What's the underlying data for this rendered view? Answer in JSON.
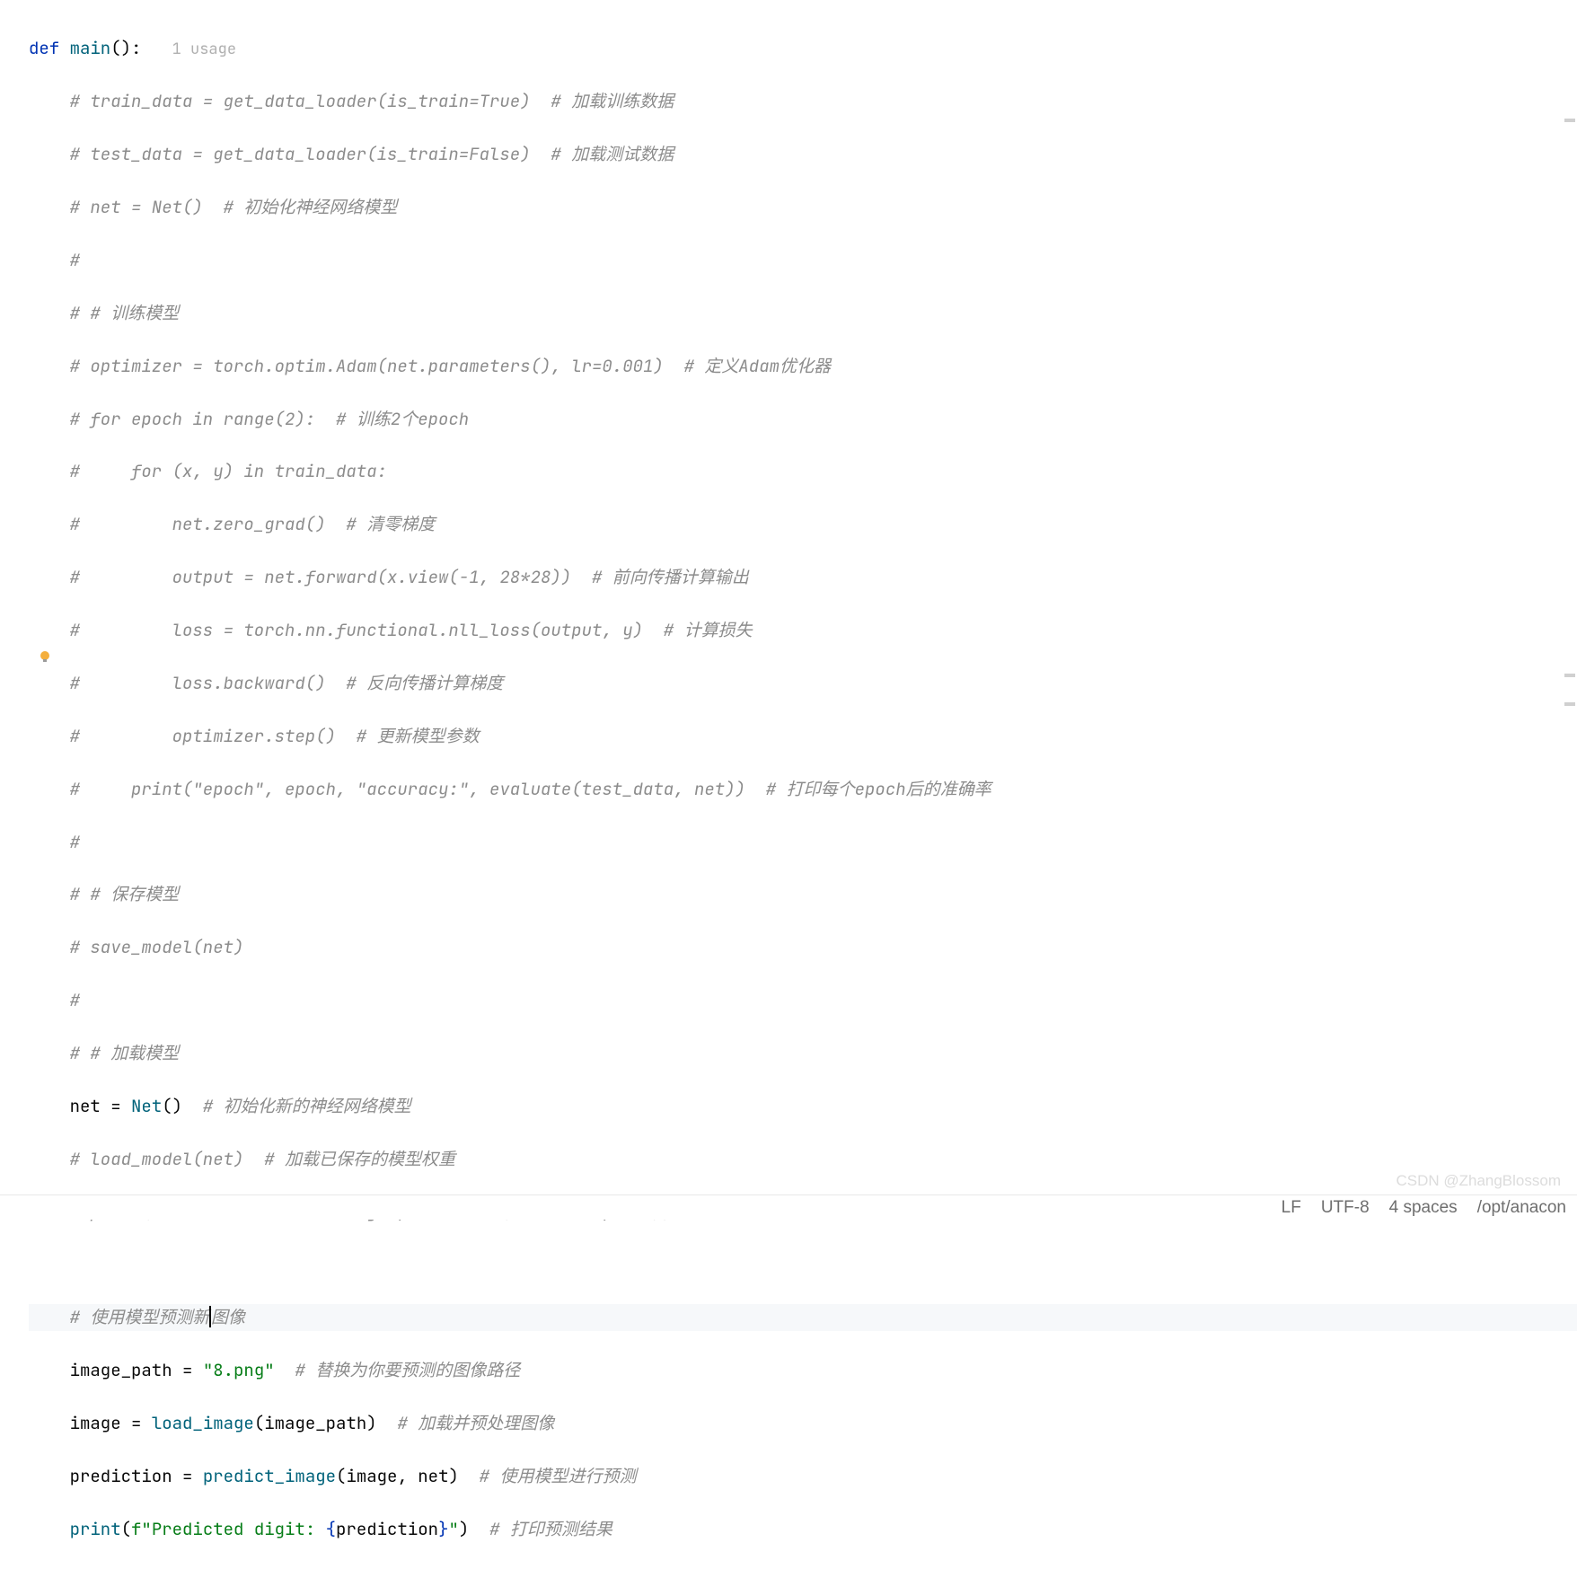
{
  "hint_usage": "1 usage",
  "code": {
    "l0_def": "def ",
    "l0_name": "main",
    "l0_paren": "():",
    "c1": "# train_data = get_data_loader(is_train=True)  # 加载训练数据",
    "c2": "# test_data = get_data_loader(is_train=False)  # 加载测试数据",
    "c3": "# net = Net()  # 初始化神经网络模型",
    "c4": "#",
    "c5": "# # 训练模型",
    "c6": "# optimizer = torch.optim.Adam(net.parameters(), lr=0.001)  # 定义Adam优化器",
    "c7": "# for epoch in range(2):  # 训练2个epoch",
    "c8": "#     for (x, y) in train_data:",
    "c9": "#         net.zero_grad()  # 清零梯度",
    "c10": "#         output = net.forward(x.view(-1, 28*28))  # 前向传播计算输出",
    "c11": "#         loss = torch.nn.functional.nll_loss(output, y)  # 计算损失",
    "c12": "#         loss.backward()  # 反向传播计算梯度",
    "c13": "#         optimizer.step()  # 更新模型参数",
    "c14": "#     print(\"epoch\", epoch, \"accuracy:\", evaluate(test_data, net))  # 打印每个epoch后的准确率",
    "c15": "#",
    "c16": "# # 保存模型",
    "c17": "# save_model(net)",
    "c18": "#",
    "c19": "# # 加载模型",
    "l20_var": "net",
    "l20_eq": " = ",
    "l20_call": "Net",
    "l20_p": "()",
    "l20_cm": "  # 初始化新的神经网络模型",
    "c21": "# load_model(net)  # 加载已保存的模型权重",
    "c22": "# print(\"Loaded model accuracy:\", evaluate(test_data, net))  # 打印加载模型后的准确率",
    "c24a": "# 使用模型预测新",
    "c24b": "图像",
    "l25_var": "image_path",
    "l25_eq": " = ",
    "l25_str": "\"8.png\"",
    "l25_cm": "  # 替换为你要预测的图像路径",
    "l26_var": "image",
    "l26_eq": " = ",
    "l26_call": "load_image",
    "l26_p1": "(",
    "l26_arg": "image_path",
    "l26_p2": ")",
    "l26_cm": "  # 加载并预处理图像",
    "l27_var": "prediction",
    "l27_eq": " = ",
    "l27_call": "predict_image",
    "l27_p1": "(",
    "l27_a1": "image",
    "l27_comma": ", ",
    "l27_a2": "net",
    "l27_p2": ")",
    "l27_cm": "  # 使用模型进行预测",
    "l28_call": "print",
    "l28_p1": "(",
    "l28_f": "f\"Predicted digit: ",
    "l28_br1": "{",
    "l28_expr": "prediction",
    "l28_br2": "}",
    "l28_q": "\"",
    "l28_p2": ")",
    "l28_cm": "  # 打印预测结果"
  },
  "status": {
    "line_sep": "LF",
    "encoding": "UTF-8",
    "indent": "4 spaces",
    "interp": "/opt/anacon"
  },
  "watermark": "CSDN @ZhangBlossom"
}
